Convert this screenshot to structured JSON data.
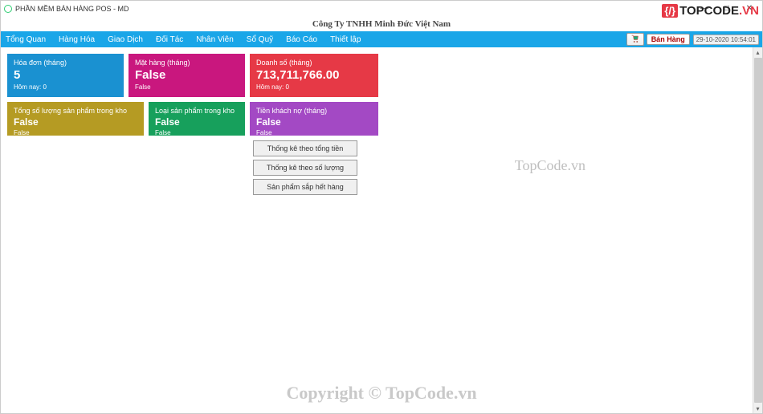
{
  "window": {
    "title": "PHẦN MỀM BÁN HÀNG POS - MD"
  },
  "header": {
    "company": "Công Ty TNHH Minh Đức Việt Nam",
    "logo_text": "TOPCODE",
    "logo_suffix": ".VN"
  },
  "menu": {
    "items": [
      "Tổng Quan",
      "Hàng Hóa",
      "Giao Dịch",
      "Đối Tác",
      "Nhân Viên",
      "Sổ Quỹ",
      "Báo Cáo",
      "Thiết lập"
    ],
    "ban_hang": "Bán Hàng",
    "datetime": "29-10-2020 10:54:01"
  },
  "tiles": {
    "row1": [
      {
        "title": "Hóa đơn (tháng)",
        "value": "5",
        "sub": "Hôm nay: 0"
      },
      {
        "title": "Mặt hàng (tháng)",
        "value": "False",
        "sub": "False"
      },
      {
        "title": "Doanh số (tháng)",
        "value": "713,711,766.00",
        "sub": "Hôm nay: 0"
      }
    ],
    "row2": [
      {
        "title": "Tổng số lượng sản phẩm trong kho",
        "value": "False",
        "sub": "False"
      },
      {
        "title": "Loại sản phẩm trong kho",
        "value": "False",
        "sub": "False"
      },
      {
        "title": "Tiền khách nợ (tháng)",
        "value": "False",
        "sub": "False"
      }
    ]
  },
  "buttons": {
    "b1": "Thống kê theo tổng tiền",
    "b2": "Thống kê theo số lượng",
    "b3": "Sản phẩm sắp hết hàng"
  },
  "watermark": {
    "mid": "TopCode.vn",
    "bottom": "Copyright © TopCode.vn"
  }
}
